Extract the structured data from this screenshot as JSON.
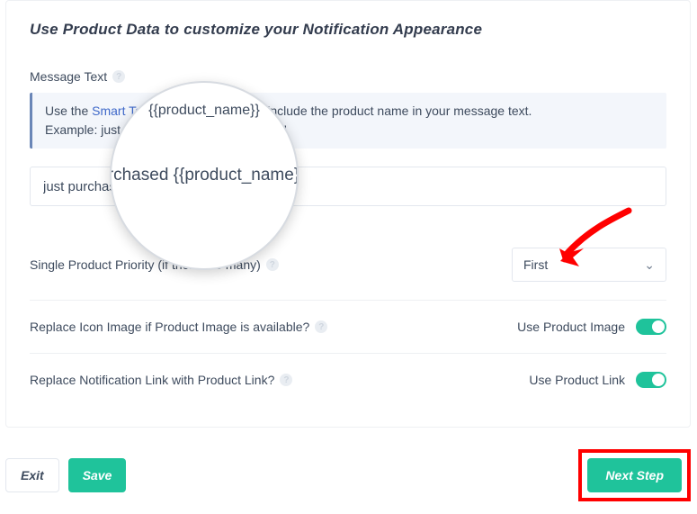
{
  "header": {
    "title": "Use Product Data to customize your Notification Appearance"
  },
  "message_text": {
    "label": "Message Text",
    "callout_prefix": "Use the ",
    "callout_link": "Smart Tag",
    "callout_middle": " {{product_name}} to include the product name in your message text.",
    "callout_example": "Example: just purchased {{product_name}}!",
    "input_value": "just purchased {{product_name}}!"
  },
  "priority": {
    "label": "Single Product Priority (if there are many)",
    "selected": "First"
  },
  "replace_icon": {
    "label": "Replace Icon Image if Product Image is available?",
    "value_label": "Use Product Image"
  },
  "replace_link": {
    "label": "Replace Notification Link with Product Link?",
    "value_label": "Use Product Link"
  },
  "footer": {
    "exit": "Exit",
    "save": "Save",
    "next": "Next Step"
  },
  "magnifier": {
    "top": "{{product_name}}",
    "main": "urchased {{product_name}}!"
  }
}
